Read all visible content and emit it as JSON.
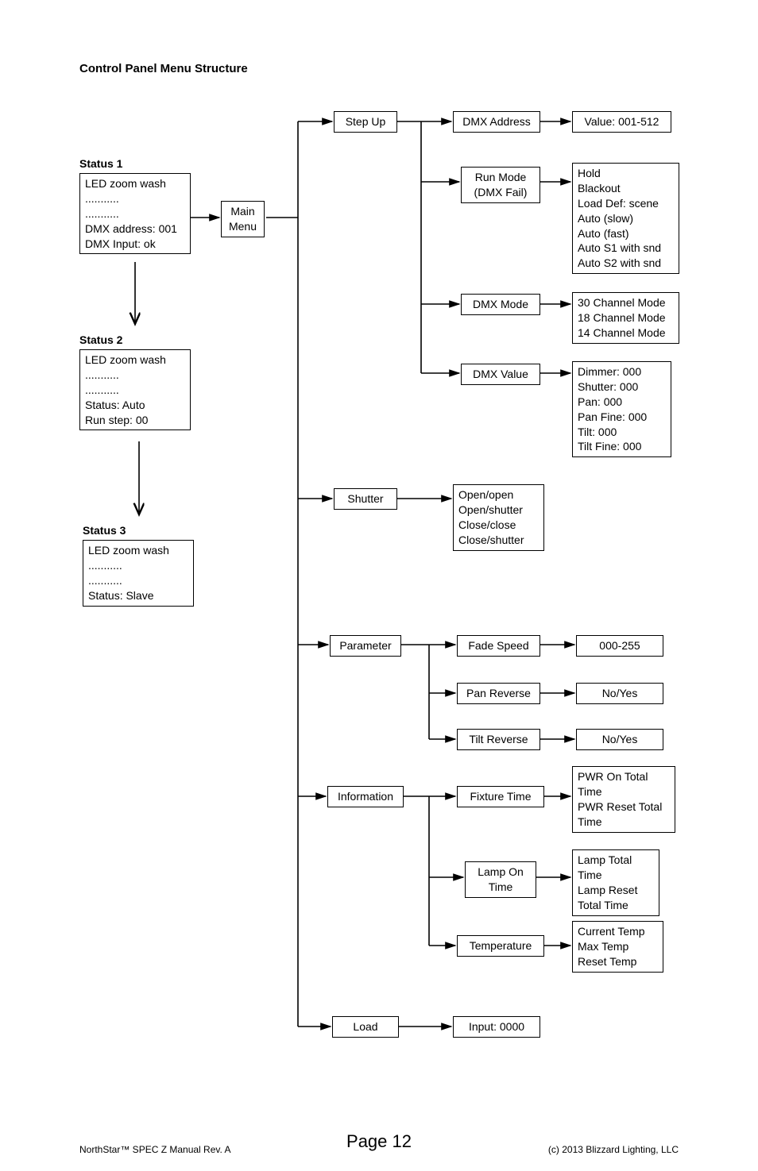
{
  "chart_data": {
    "type": "diagram",
    "title": "Control Panel Menu Structure",
    "status_screens": [
      {
        "name": "Status 1",
        "lines": [
          "LED zoom wash",
          "...........",
          "...........",
          "DMX address: 001",
          "DMX Input: ok"
        ]
      },
      {
        "name": "Status 2",
        "lines": [
          "LED zoom wash",
          "...........",
          "...........",
          "Status: Auto",
          "Run step: 00"
        ]
      },
      {
        "name": "Status 3",
        "lines": [
          "LED zoom wash",
          "...........",
          "...........",
          "Status: Slave"
        ]
      }
    ],
    "root": "Main Menu",
    "menu_tree": [
      {
        "item": "Step Up",
        "children": [
          {
            "item": "DMX Address",
            "value": "Value: 001-512"
          },
          {
            "item": "Run Mode (DMX Fail)",
            "options": [
              "Hold",
              "Blackout",
              "Load Def: scene",
              "Auto (slow)",
              "Auto (fast)",
              "Auto S1 with snd",
              "Auto S2 with snd"
            ]
          },
          {
            "item": "DMX Mode",
            "options": [
              "30 Channel Mode",
              "18 Channel Mode",
              "14 Channel Mode"
            ]
          },
          {
            "item": "DMX Value",
            "options": [
              "Dimmer: 000",
              "Shutter: 000",
              "Pan: 000",
              "Pan Fine: 000",
              "Tilt: 000",
              "Tilt Fine: 000"
            ]
          }
        ]
      },
      {
        "item": "Shutter",
        "options": [
          "Open/open",
          "Open/shutter",
          "Close/close",
          "Close/shutter"
        ]
      },
      {
        "item": "Parameter",
        "children": [
          {
            "item": "Fade Speed",
            "value": "000-255"
          },
          {
            "item": "Pan Reverse",
            "value": "No/Yes"
          },
          {
            "item": "Tilt Reverse",
            "value": "No/Yes"
          }
        ]
      },
      {
        "item": "Information",
        "children": [
          {
            "item": "Fixture Time",
            "options": [
              "PWR On Total Time",
              "PWR Reset Total Time"
            ]
          },
          {
            "item": "Lamp On Time",
            "options": [
              "Lamp Total Time",
              "Lamp Reset Total Time"
            ]
          },
          {
            "item": "Temperature",
            "options": [
              "Current Temp",
              "Max Temp",
              "Reset Temp"
            ]
          }
        ]
      },
      {
        "item": "Load",
        "value": "Input: 0000"
      }
    ]
  },
  "title": "Control Panel Menu Structure",
  "status1": {
    "label": "Status 1",
    "body": "LED zoom wash\n...........\n...........\nDMX address: 001\nDMX Input: ok"
  },
  "status2": {
    "label": "Status 2",
    "body": "LED zoom wash\n...........\n...........\nStatus: Auto\nRun step: 00"
  },
  "status3": {
    "label": "Status 3",
    "body": "LED zoom wash\n...........\n...........\nStatus: Slave"
  },
  "mainmenu": "Main\nMenu",
  "stepup": "Step Up",
  "dmxaddr": "DMX Address",
  "dmxaddr_val": "Value: 001-512",
  "runmode": "Run Mode\n(DMX Fail)",
  "runmode_opts": "Hold\nBlackout\nLoad Def: scene\nAuto (slow)\nAuto (fast)\nAuto S1 with snd\nAuto S2 with snd",
  "dmxmode": "DMX Mode",
  "dmxmode_opts": "30 Channel Mode\n18 Channel Mode\n14 Channel Mode",
  "dmxvalue": "DMX Value",
  "dmxvalue_opts": "Dimmer: 000\nShutter: 000\nPan: 000\nPan Fine: 000\nTilt: 000\nTilt Fine: 000",
  "shutter": "Shutter",
  "shutter_opts": "Open/open\nOpen/shutter\nClose/close\nClose/shutter",
  "parameter": "Parameter",
  "fadespeed": "Fade Speed",
  "fadespeed_val": "000-255",
  "panrev": "Pan Reverse",
  "panrev_val": "No/Yes",
  "tiltrev": "Tilt Reverse",
  "tiltrev_val": "No/Yes",
  "information": "Information",
  "fixturetime": "Fixture Time",
  "fixturetime_opts": "PWR On Total\nTime\nPWR Reset Total\nTime",
  "lampon": "Lamp On\nTime",
  "lampon_opts": "Lamp Total\nTime\nLamp Reset\nTotal Time",
  "temperature": "Temperature",
  "temperature_opts": "Current Temp\nMax Temp\nReset Temp",
  "load": "Load",
  "load_val": "Input: 0000",
  "footer": {
    "left": "NorthStar™ SPEC Z Manual Rev. A",
    "center": "Page 12",
    "right": "(c) 2013 Blizzard Lighting, LLC"
  }
}
